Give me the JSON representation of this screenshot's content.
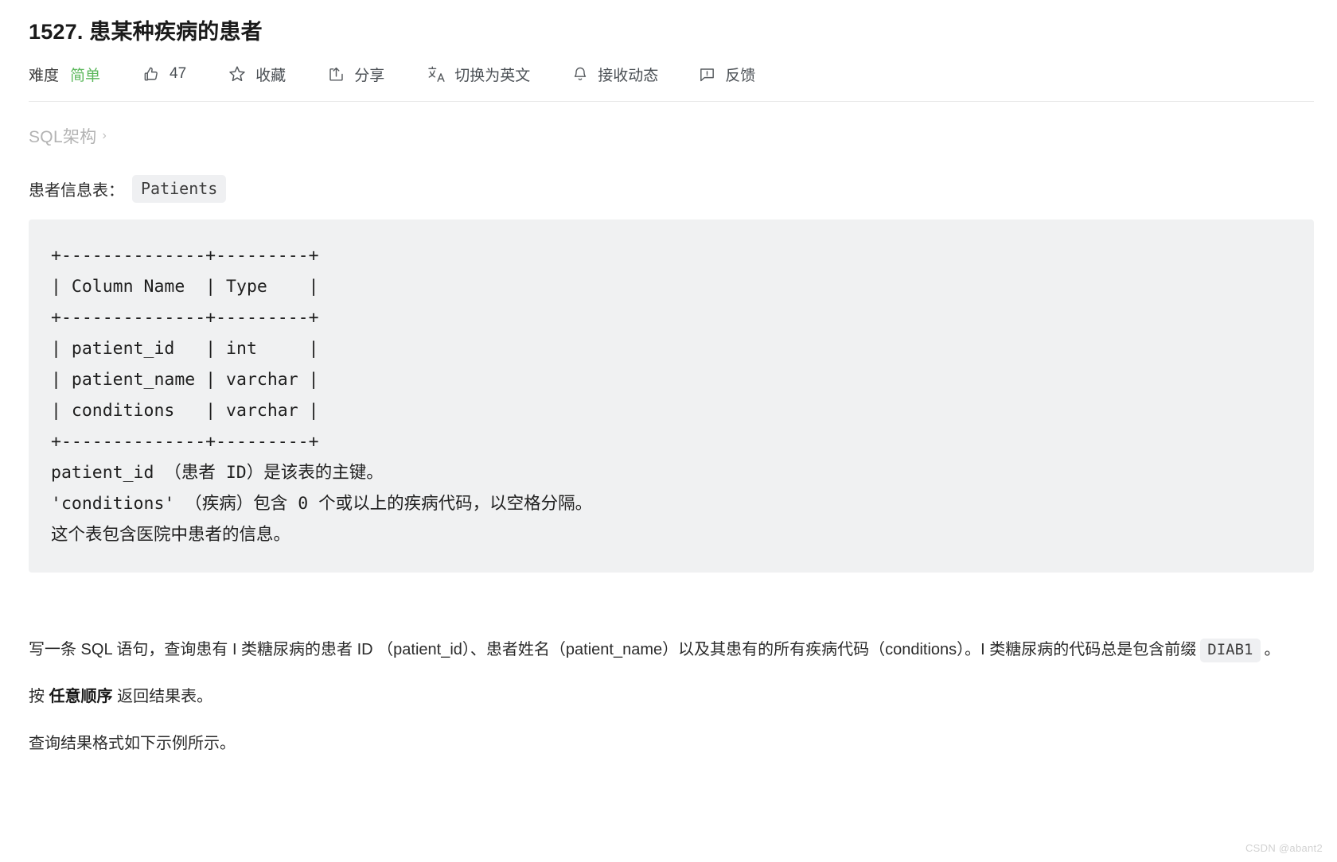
{
  "problem": {
    "title": "1527. 患某种疾病的患者"
  },
  "toolbar": {
    "difficulty_label": "难度",
    "difficulty_value": "简单",
    "difficulty_color": "#5cb85c",
    "like_icon": "thumbs-up-icon",
    "like_count": "47",
    "favorite_icon": "star-icon",
    "favorite_label": "收藏",
    "share_icon": "share-icon",
    "share_label": "分享",
    "translate_icon": "translate-icon",
    "translate_label": "切换为英文",
    "subscribe_icon": "bell-icon",
    "subscribe_label": "接收动态",
    "feedback_icon": "feedback-icon",
    "feedback_label": "反馈"
  },
  "breadcrumb": {
    "label": "SQL架构",
    "chevron": "›"
  },
  "schema": {
    "table_caption": "患者信息表：",
    "table_name": "Patients",
    "code": "+--------------+---------+\n| Column Name  | Type    |\n+--------------+---------+\n| patient_id   | int     |\n| patient_name | varchar |\n| conditions   | varchar |\n+--------------+---------+\npatient_id （患者 ID）是该表的主键。\n'conditions' （疾病）包含 0 个或以上的疾病代码，以空格分隔。\n这个表包含医院中患者的信息。"
  },
  "description": {
    "part1": "写一条 SQL 语句，查询患有 I 类糖尿病的患者 ID （patient_id）、患者姓名（patient_name）以及其患有的所有疾病代码（conditions）。I 类糖尿病的代码总是包含前缀",
    "code_chip": "DIAB1",
    "part2": "。",
    "order_prefix": "按 ",
    "order_bold": "任意顺序",
    "order_suffix": " 返回结果表。",
    "format_note": "查询结果格式如下示例所示。"
  },
  "watermark": "CSDN @abant2"
}
